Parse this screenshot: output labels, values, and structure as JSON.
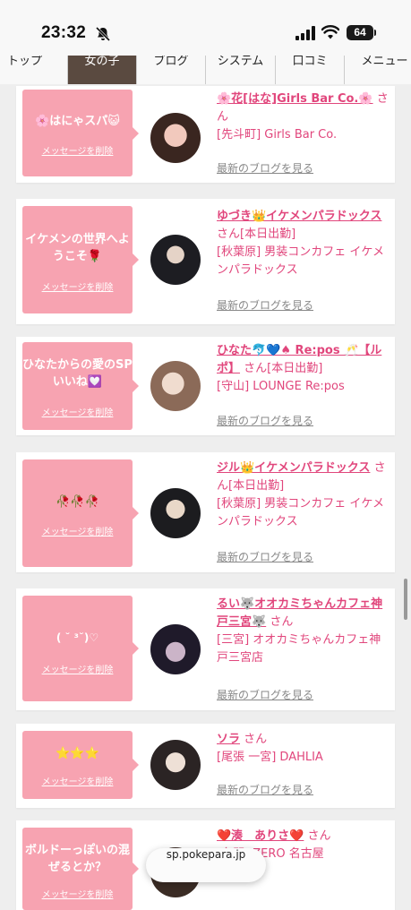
{
  "status": {
    "time": "23:32",
    "battery": "64"
  },
  "tabs": [
    {
      "label": "トップ"
    },
    {
      "label": "女の子"
    },
    {
      "label": "ブログ"
    },
    {
      "label": "システム"
    },
    {
      "label": "口コミ"
    },
    {
      "label": "メニュー"
    }
  ],
  "cards": [
    {
      "message": "🌸はにゃスパ😺",
      "delete_label": "メッセージを削除",
      "name": "🌸花[はな]Girls Bar Co.🌸",
      "san": "さん",
      "tag": "",
      "shop": "[先斗町] Girls Bar Co.",
      "blog": "最新のブログを見る"
    },
    {
      "message": "イケメンの世界へようこそ🌹",
      "delete_label": "メッセージを削除",
      "name": "ゆづき👑イケメンパラドックス",
      "san": "さん",
      "tag": "[本日出勤]",
      "shop": "[秋葉原] 男装コンカフェ イケメンパラドックス",
      "blog": "最新のブログを見る"
    },
    {
      "message": "ひなたからの愛のSPいいね💟",
      "delete_label": "メッセージを削除",
      "name": "ひなた🐬💙♠ Re:pos 🥂【ルポ】",
      "san": "さん",
      "tag": "[本日出勤]",
      "shop": "[守山] LOUNGE Re:pos",
      "blog": "最新のブログを見る"
    },
    {
      "message": "🥀🥀🥀",
      "delete_label": "メッセージを削除",
      "name": "ジル👑イケメンパラドックス",
      "san": "さん",
      "tag": "[本日出勤]",
      "shop": "[秋葉原] 男装コンカフェ イケメンパラドックス",
      "blog": "最新のブログを見る"
    },
    {
      "message": "( ˘ ³˘)♡",
      "delete_label": "メッセージを削除",
      "name": "るい🐺オオカミちゃんカフェ神戸三宮🐺",
      "san": "さん",
      "tag": "",
      "shop": "[三宮] オオカミちゃんカフェ神戸三宮店",
      "blog": "最新のブログを見る"
    },
    {
      "message": "⭐⭐⭐",
      "delete_label": "メッセージを削除",
      "name": "ソラ",
      "san": "さん",
      "tag": "",
      "shop": "[尾張 一宮] DAHLIA",
      "blog": "最新のブログを見る"
    },
    {
      "message": "ボルドーっぽいの混ぜるとか？",
      "delete_label": "メッセージを削除",
      "name": "❤️湊　ありさ❤️",
      "san": "さん",
      "tag": "",
      "shop": "[名駅] ZERO 名古屋",
      "blog": ""
    }
  ],
  "url": "sp.pokepara.jp",
  "colors": {
    "accent": "#e1467c",
    "bubble": "#f7a3b1",
    "active_tab": "#5a4a40"
  }
}
